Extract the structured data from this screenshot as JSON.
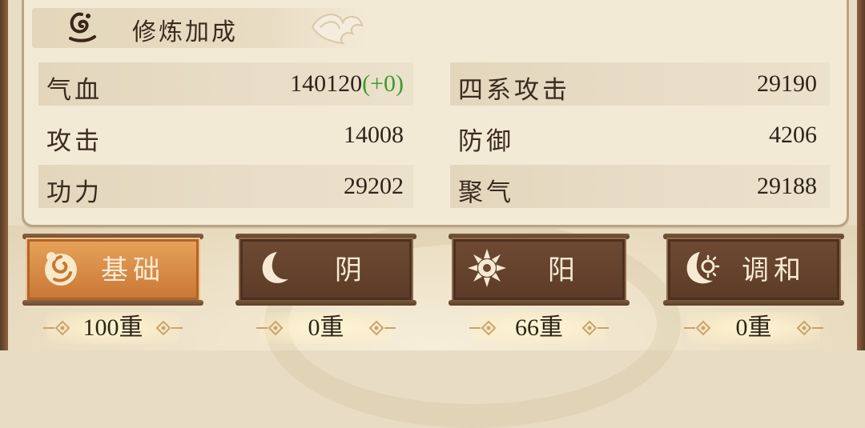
{
  "header": {
    "title": "修炼加成",
    "icon": "swirl-emblem-icon"
  },
  "stats": [
    {
      "label": "气血",
      "value": "140120",
      "bonus": "(+0)"
    },
    {
      "label": "四系攻击",
      "value": "29190",
      "bonus": ""
    },
    {
      "label": "攻击",
      "value": "14008",
      "bonus": ""
    },
    {
      "label": "防御",
      "value": "4206",
      "bonus": ""
    },
    {
      "label": "功力",
      "value": "29202",
      "bonus": ""
    },
    {
      "label": "聚气",
      "value": "29188",
      "bonus": ""
    }
  ],
  "tabs": [
    {
      "label": "基础",
      "icon": "yinyang-spiral-icon",
      "count": "100重",
      "active": true
    },
    {
      "label": "阴",
      "icon": "crescent-moon-icon",
      "count": "0重",
      "active": false
    },
    {
      "label": "阳",
      "icon": "sun-icon",
      "count": "66重",
      "active": false
    },
    {
      "label": "调和",
      "icon": "moon-sun-icon",
      "count": "0重",
      "active": false
    }
  ],
  "colors": {
    "bonus": "#3d9a2e",
    "active_tab": "#d8893f",
    "inactive_tab": "#5f3e29",
    "panel": "#f3ead6"
  }
}
